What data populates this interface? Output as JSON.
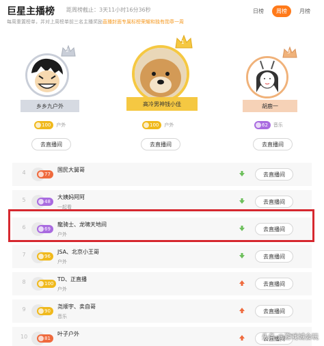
{
  "header": {
    "title": "巨星主播榜",
    "countdown": "距周榜截止：3天11小时16分36秒",
    "subtitle_plain": "每周重置榜单，并对上周榜单前三名主播奖励",
    "subtitle_highlight": "直播封面专属标榜荣耀和独有勋章一周",
    "tabs": [
      "日榜",
      "周榜",
      "月榜"
    ],
    "active_tab": "周榜"
  },
  "top3": [
    {
      "rank": "2",
      "name": "乡乡九户外",
      "level": "100",
      "level_color": "orange",
      "category": "户外",
      "button": "去直播间"
    },
    {
      "rank": "1",
      "name": "高冷男神钱小佳",
      "level": "100",
      "level_color": "orange",
      "category": "户外",
      "button": "去直播间"
    },
    {
      "rank": "3",
      "name": "胡鹿一",
      "level": "62",
      "level_color": "purple",
      "category": "音乐",
      "button": "去直播间"
    }
  ],
  "list": [
    {
      "rank": "4",
      "level": "77",
      "level_color": "red",
      "name": "国民大舅哥",
      "sub": "",
      "trend": "down",
      "button": "去直播间"
    },
    {
      "rank": "5",
      "level": "48",
      "level_color": "purple",
      "name": "大姨妈阿阿",
      "sub": "一起看",
      "trend": "down",
      "button": "去直播间"
    },
    {
      "rank": "6",
      "level": "69",
      "level_color": "purple",
      "name": "龍骑士、龙啸天地间",
      "sub": "户外",
      "trend": "down",
      "button": "去直播间"
    },
    {
      "rank": "7",
      "level": "96",
      "level_color": "orange",
      "name": "JSA、北京小王哥",
      "sub": "户外",
      "trend": "down",
      "button": "去直播间"
    },
    {
      "rank": "8",
      "level": "100",
      "level_color": "orange",
      "name": "TD、正直播",
      "sub": "户外",
      "trend": "up",
      "button": "去直播间"
    },
    {
      "rank": "9",
      "level": "90",
      "level_color": "orange",
      "name": "尧顺宇、卖自哥",
      "sub": "音乐",
      "trend": "up",
      "button": "去直播间"
    },
    {
      "rank": "10",
      "level": "81",
      "level_color": "red",
      "name": "叶子户外",
      "sub": "",
      "trend": "up",
      "button": "去直播间"
    }
  ],
  "colors": {
    "accent": "#ff7a1a",
    "highlight_box": "#d6282f",
    "trend_up": "#ef6a3d",
    "trend_down": "#6cbf5b"
  },
  "watermark": "头条 @游戏城会玩"
}
